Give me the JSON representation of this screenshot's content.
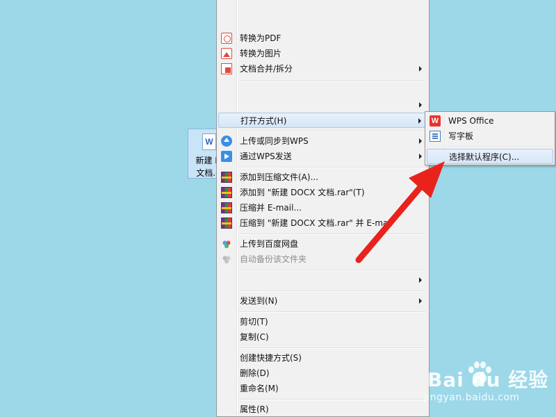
{
  "desktop_icon": {
    "glyph": "W",
    "name": "新建 D\n文档.d"
  },
  "context_menu": {
    "items": [
      {
        "label": "转换为PDF",
        "icon": "pdf-convert-icon"
      },
      {
        "label": "转换为图片",
        "icon": "image-convert-icon"
      },
      {
        "label": "文档合并/拆分",
        "icon": "merge-split-icon",
        "submenu": true
      },
      {
        "label": "",
        "submenu": true
      },
      {
        "label": "打开方式(H)",
        "submenu": true,
        "highlighted": true
      },
      {
        "label": "上传或同步到WPS",
        "icon": "wps-cloud-icon",
        "submenu": true
      },
      {
        "label": "通过WPS发送",
        "icon": "wps-send-icon",
        "submenu": true
      },
      {
        "label": "添加到压缩文件(A)...",
        "icon": "winrar-icon"
      },
      {
        "label": "添加到 \"新建 DOCX 文档.rar\"(T)",
        "icon": "winrar-icon"
      },
      {
        "label": "压缩并 E-mail...",
        "icon": "winrar-icon"
      },
      {
        "label": "压缩到 \"新建 DOCX 文档.rar\" 并 E-mail",
        "icon": "winrar-icon"
      },
      {
        "label": "上传到百度网盘",
        "icon": "baidu-netdisk-icon"
      },
      {
        "label": "自动备份该文件夹",
        "icon": "baidu-netdisk-icon",
        "disabled": true
      },
      {
        "label": "",
        "submenu": true
      },
      {
        "label": "发送到(N)",
        "submenu": true
      },
      {
        "label": "剪切(T)"
      },
      {
        "label": "复制(C)"
      },
      {
        "label": "创建快捷方式(S)"
      },
      {
        "label": "删除(D)"
      },
      {
        "label": "重命名(M)"
      },
      {
        "label": "属性(R)"
      }
    ]
  },
  "open_with_submenu": {
    "items": [
      {
        "label": "WPS Office",
        "icon": "wps-office-icon",
        "glyph": "W"
      },
      {
        "label": "写字板",
        "icon": "wordpad-icon"
      },
      {
        "label": "选择默认程序(C)...",
        "highlighted": true
      }
    ]
  },
  "annotation": {
    "color": "#e8231c"
  },
  "watermark": {
    "brand": "Bai du 经验",
    "url": "jingyan.baidu.com"
  },
  "colors": {
    "desktop_bg": "#9cd8e8",
    "menu_bg": "#f1f1f1",
    "highlight_border": "#a8c8ec"
  }
}
